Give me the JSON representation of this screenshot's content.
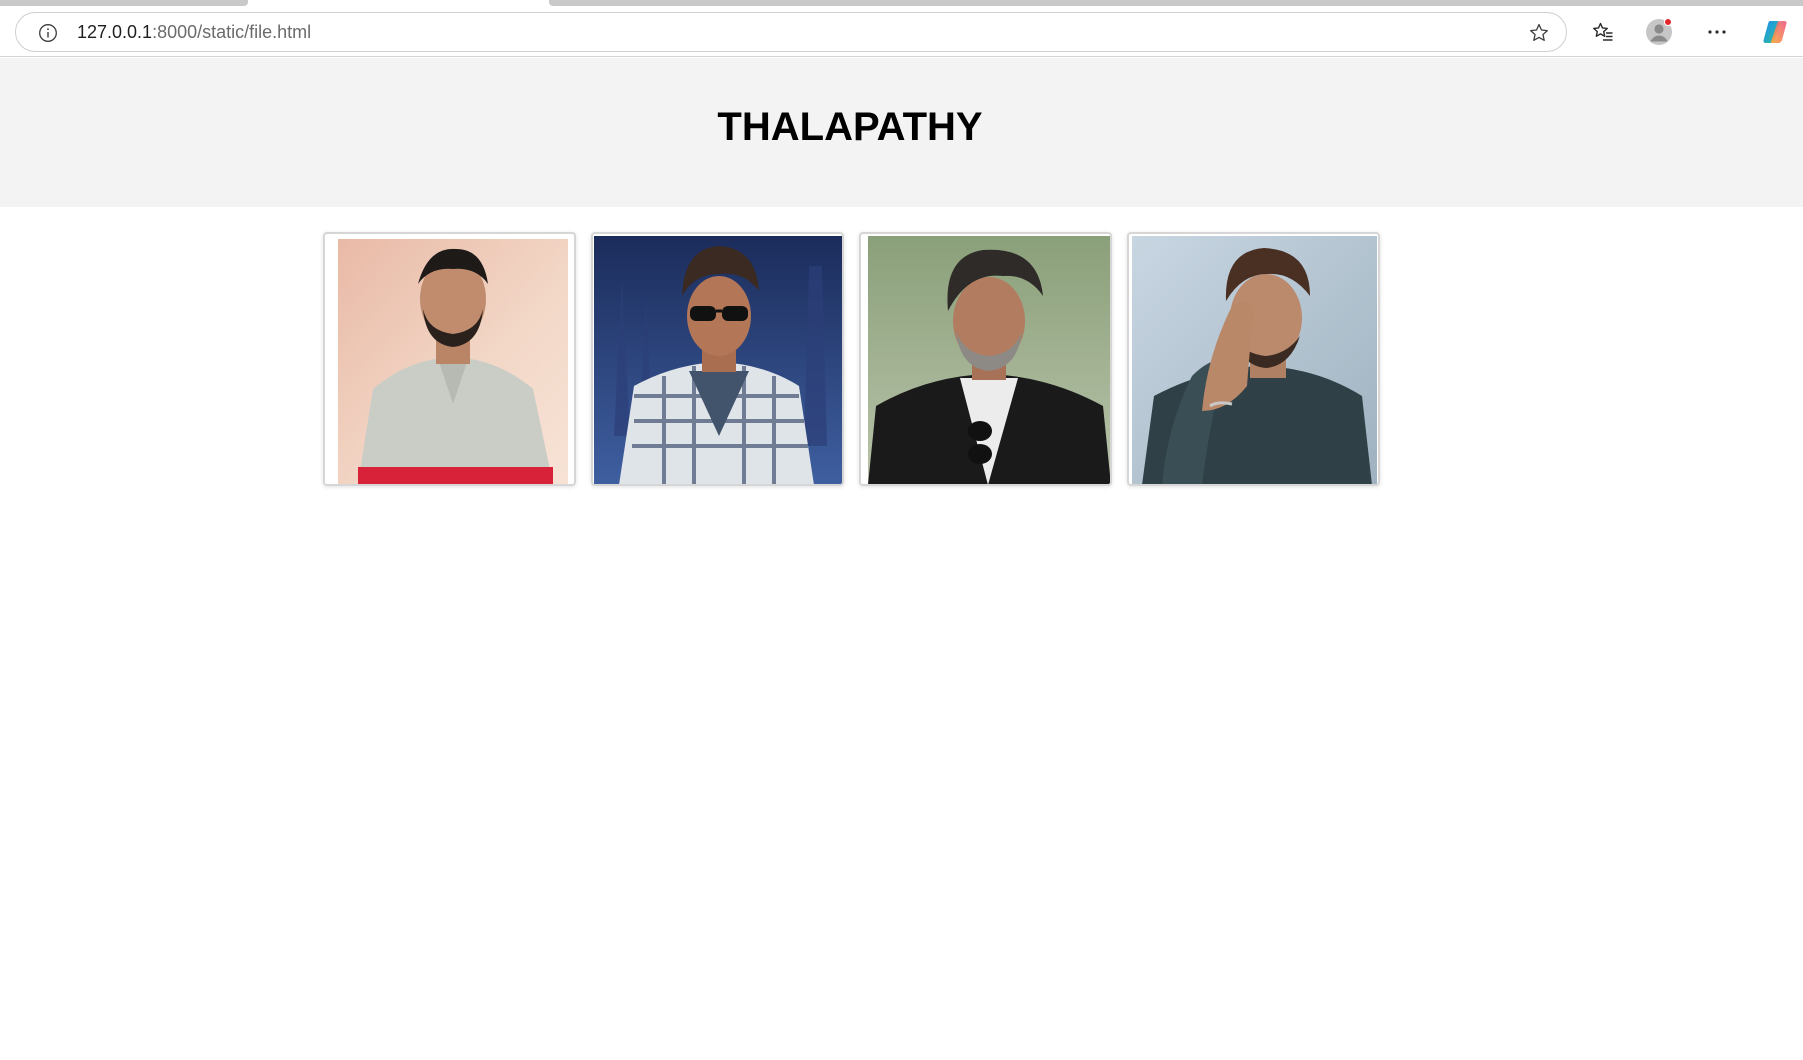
{
  "browser": {
    "url_host": "127.0.0.1",
    "url_path": ":8000/static/file.html",
    "icons": [
      "info-icon",
      "star-icon",
      "favorites-icon",
      "profile-avatar-icon",
      "more-menu-icon",
      "copilot-icon"
    ],
    "notification_dot_color": "#e0262b"
  },
  "page": {
    "title": "THALAPATHY",
    "header_bg": "#f3f3f3",
    "photos": [
      {
        "name": "photo-1",
        "description_icon": "portrait-photo"
      },
      {
        "name": "photo-2",
        "description_icon": "portrait-photo"
      },
      {
        "name": "photo-3",
        "description_icon": "portrait-photo"
      },
      {
        "name": "photo-4",
        "description_icon": "portrait-photo"
      }
    ]
  }
}
